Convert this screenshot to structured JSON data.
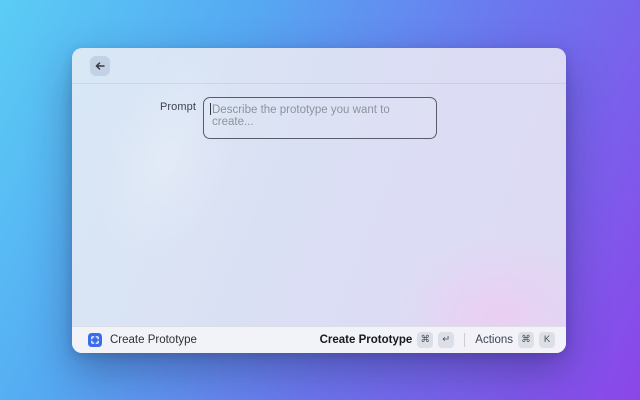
{
  "colors": {
    "accent_blue": "#3b6cec",
    "wallpaper_start": "#5bcdf5",
    "wallpaper_end": "#8b46e9"
  },
  "window": {
    "form": {
      "prompt_label": "Prompt",
      "prompt_value": "",
      "prompt_placeholder": "Describe the prototype you want to create..."
    },
    "statusbar": {
      "source_label": "Create Prototype",
      "primary_action": {
        "label": "Create Prototype",
        "keys": [
          "⌘",
          "↵"
        ]
      },
      "actions_menu": {
        "label": "Actions",
        "keys": [
          "⌘",
          "K"
        ]
      }
    }
  }
}
